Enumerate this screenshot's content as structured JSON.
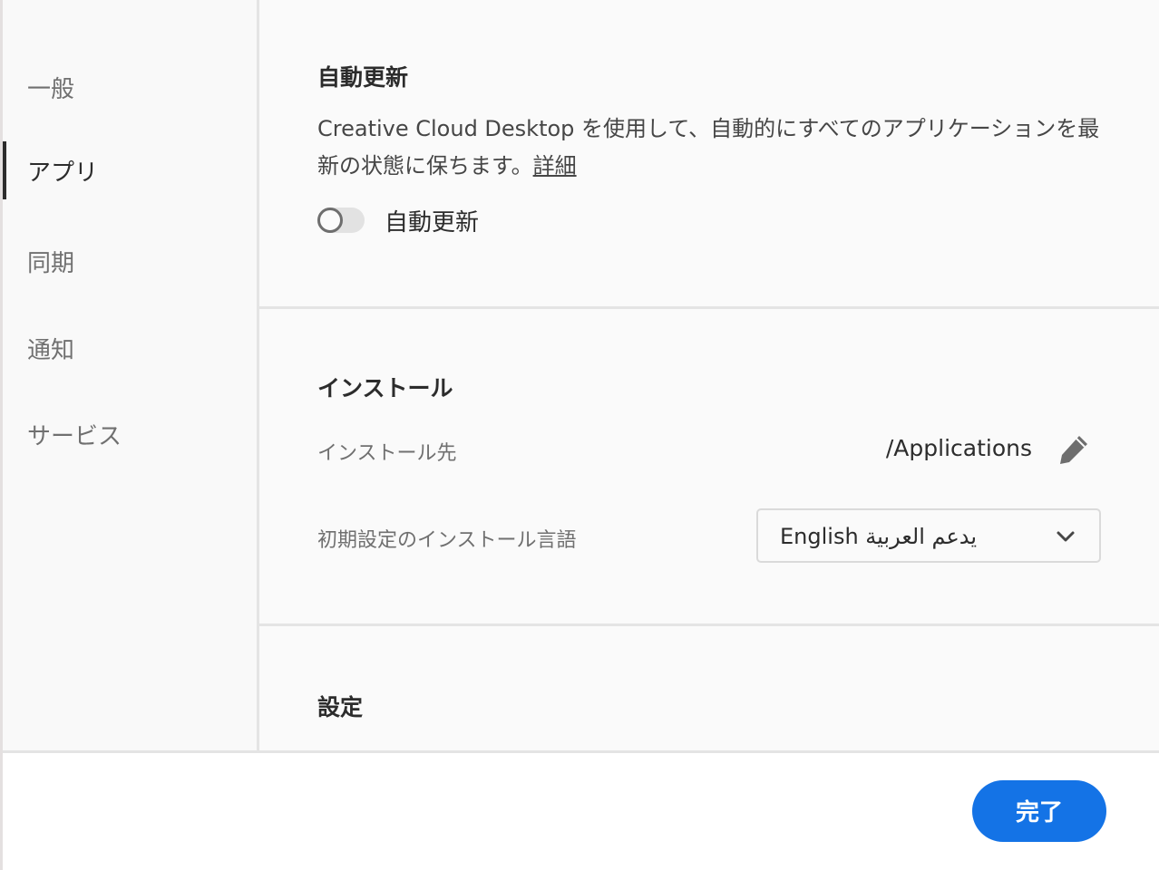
{
  "sidebar": {
    "items": [
      {
        "label": "一般",
        "active": false
      },
      {
        "label": "アプリ",
        "active": true
      },
      {
        "label": "同期",
        "active": false
      },
      {
        "label": "通知",
        "active": false
      },
      {
        "label": "サービス",
        "active": false
      }
    ]
  },
  "auto_update": {
    "title": "自動更新",
    "description": "Creative Cloud Desktop を使用して、自動的にすべてのアプリケーションを最新の状態に保ちます。",
    "learn_more_link": "詳細",
    "toggle_label": "自動更新",
    "toggle_on": false
  },
  "install": {
    "title": "インストール",
    "location_label": "インストール先",
    "location_value": "/Applications",
    "location_edit_icon": "pencil-icon",
    "language_label": "初期設定のインストール言語",
    "language_value": "English يدعم العربية"
  },
  "settings": {
    "title": "設定"
  },
  "footer": {
    "done_label": "完了"
  },
  "colors": {
    "accent": "#1473e6",
    "active_indicator": "#2c2c2c"
  }
}
